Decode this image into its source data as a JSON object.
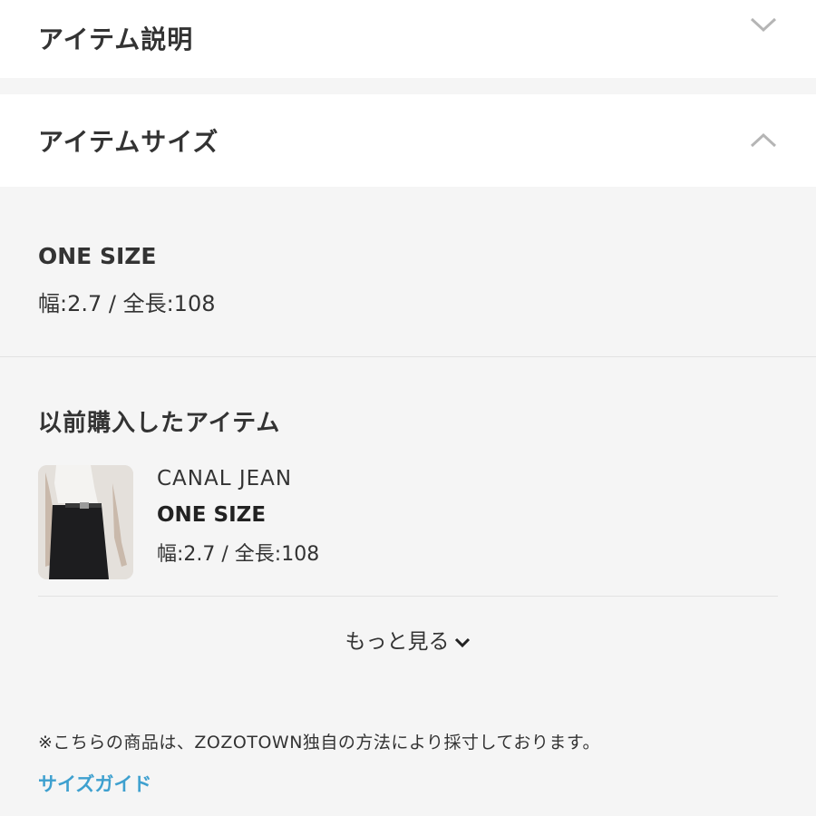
{
  "sections": {
    "description": {
      "title": "アイテム説明",
      "state": "collapsed"
    },
    "size": {
      "title": "アイテムサイズ",
      "state": "expanded"
    }
  },
  "size_info": {
    "name": "ONE SIZE",
    "measurements": "幅:2.7 / 全長:108"
  },
  "previous_purchases": {
    "title": "以前購入したアイテム",
    "items": [
      {
        "brand": "CANAL JEAN",
        "size": "ONE SIZE",
        "measurements": "幅:2.7 / 全長:108"
      }
    ],
    "more_label": "もっと見る"
  },
  "note": "※こちらの商品は、ZOZOTOWN独自の方法により採寸しております。",
  "size_guide_label": "サイズガイド",
  "colors": {
    "link": "#3ea0cf",
    "text": "#333333",
    "panel_bg": "#f5f5f5"
  }
}
